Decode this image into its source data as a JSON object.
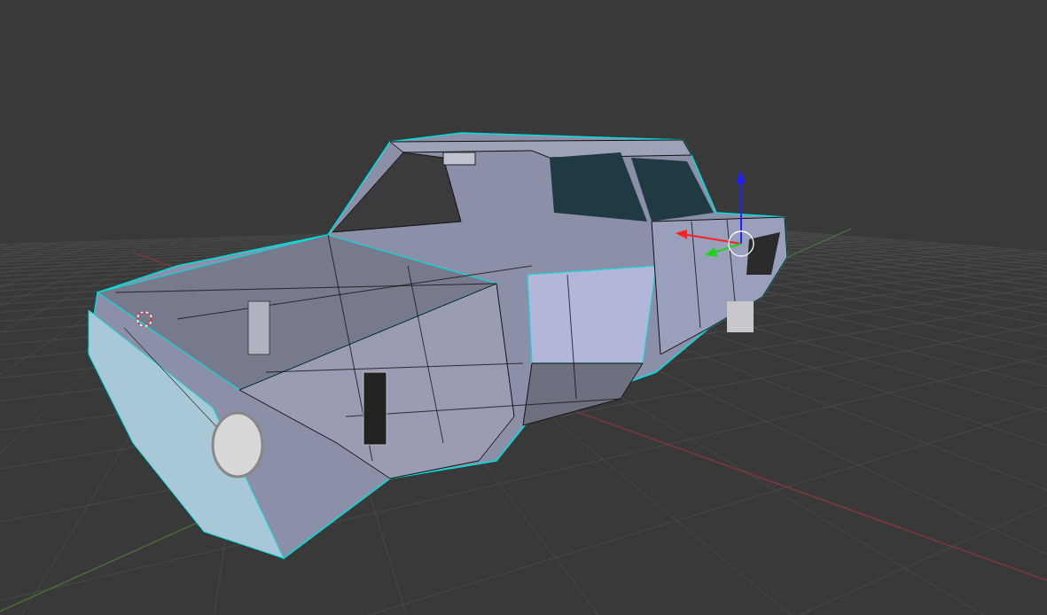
{
  "viewport": {
    "show_grid": true,
    "show_manipulator": true
  }
}
